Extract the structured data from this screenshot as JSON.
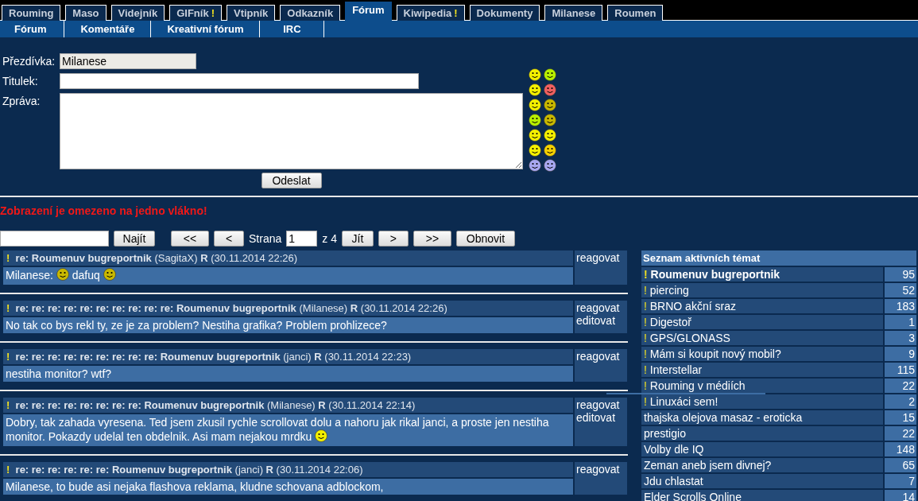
{
  "main_tabs": [
    {
      "label": "Rouming",
      "alert": false,
      "selected": false
    },
    {
      "label": "Maso",
      "alert": false,
      "selected": false
    },
    {
      "label": "Videjník",
      "alert": false,
      "selected": false
    },
    {
      "label": "GIFník",
      "alert": true,
      "selected": false
    },
    {
      "label": "Vtipník",
      "alert": false,
      "selected": false
    },
    {
      "label": "Odkazník",
      "alert": false,
      "selected": false
    },
    {
      "label": "Fórum",
      "alert": false,
      "selected": true
    },
    {
      "label": "Kiwipedia",
      "alert": true,
      "selected": false
    },
    {
      "label": "Dokumenty",
      "alert": false,
      "selected": false
    },
    {
      "label": "Milanese",
      "alert": false,
      "selected": false
    },
    {
      "label": "Roumen",
      "alert": false,
      "selected": false
    }
  ],
  "alert_mark": "!",
  "sub_tabs": [
    "Fórum",
    "Komentáře",
    "Kreativní fórum",
    "IRC"
  ],
  "form": {
    "nick_label": "Přezdívka:",
    "nick_value": "Milanese",
    "title_label": "Titulek:",
    "message_label": "Zpráva:",
    "submit": "Odeslat"
  },
  "notice": "Zobrazení je omezeno na jedno vlákno!",
  "pager": {
    "search_button": "Najít",
    "first": "<<",
    "prev": "<",
    "page_label": "Strana",
    "page_value": "1",
    "of_label": "z 4",
    "go": "Jít",
    "next": ">",
    "last": ">>",
    "refresh": "Obnovit"
  },
  "posts": [
    {
      "mark": "!",
      "prefix": "re:",
      "title": "Roumenuv bugreportnik",
      "author": "(SagitaX)",
      "reply": "R",
      "date": "(30.11.2014 22:26)",
      "body": [
        {
          "kind": "text",
          "text": "Milanese: "
        },
        {
          "kind": "emoticon"
        },
        {
          "kind": "text",
          "text": " dafuq "
        },
        {
          "kind": "emoticon"
        }
      ],
      "actions": [
        "reagovat"
      ]
    },
    {
      "mark": "!",
      "prefix": "re: re: re: re: re: re: re: re: re: re:",
      "title": "Roumenuv bugreportnik",
      "author": "(Milanese)",
      "reply": "R",
      "date": "(30.11.2014 22:26)",
      "body": [
        {
          "kind": "text",
          "text": "No tak co bys rekl ty, ze je za problem? Nestiha grafika? Problem prohlizece?"
        }
      ],
      "actions": [
        "reagovat",
        "editovat"
      ]
    },
    {
      "mark": "!",
      "prefix": "re: re: re: re: re: re: re: re: re:",
      "title": "Roumenuv bugreportnik",
      "author": "(janci)",
      "reply": "R",
      "date": "(30.11.2014 22:23)",
      "body": [
        {
          "kind": "text",
          "text": "nestiha monitor? wtf?"
        }
      ],
      "actions": [
        "reagovat"
      ]
    },
    {
      "mark": "!",
      "prefix": "re: re: re: re: re: re: re: re:",
      "title": "Roumenuv bugreportnik",
      "author": "(Milanese)",
      "reply": "R",
      "date": "(30.11.2014 22:14)",
      "body": [
        {
          "kind": "text",
          "text": "Dobry, tak zahada vyresena. Ted jsem zkusil rychle scrollovat dolu a nahoru jak rikal janci, a proste jen nestiha monitor. Pokazdy udelal ten obdelnik. Asi mam nejakou mrdku "
        },
        {
          "kind": "smiley"
        }
      ],
      "actions": [
        "reagovat",
        "editovat"
      ]
    },
    {
      "mark": "!",
      "prefix": "re: re: re: re: re: re:",
      "title": "Roumenuv bugreportnik",
      "author": "(janci)",
      "reply": "R",
      "date": "(30.11.2014 22:06)",
      "body": [
        {
          "kind": "text",
          "text": "Milanese, to bude asi nejaka flashova reklama, kludne schovana adblockom,"
        }
      ],
      "actions": [
        "reagovat"
      ]
    }
  ],
  "topics": {
    "title": "Seznam aktivních témat",
    "items": [
      {
        "title": "Roumenuv bugreportnik",
        "count": "95",
        "flagged": true,
        "current": true
      },
      {
        "title": "piercing",
        "count": "52",
        "flagged": true,
        "current": false
      },
      {
        "title": "BRNO akční sraz",
        "count": "183",
        "flagged": true,
        "current": false
      },
      {
        "title": "Digestoř",
        "count": "1",
        "flagged": true,
        "current": false
      },
      {
        "title": "GPS/GLONASS",
        "count": "3",
        "flagged": true,
        "current": false
      },
      {
        "title": "Mám si koupit nový mobil?",
        "count": "9",
        "flagged": true,
        "current": false
      },
      {
        "title": "Interstellar",
        "count": "115",
        "flagged": true,
        "current": false
      },
      {
        "title": "Rouming v médiích",
        "count": "22",
        "flagged": true,
        "current": false
      },
      {
        "title": "Linuxáci sem!",
        "count": "2",
        "flagged": true,
        "current": false
      },
      {
        "title": "thajska olejova masaz - eroticka",
        "count": "15",
        "flagged": false,
        "current": false
      },
      {
        "title": "prestigio",
        "count": "22",
        "flagged": false,
        "current": false
      },
      {
        "title": "Volby dle IQ",
        "count": "148",
        "flagged": false,
        "current": false
      },
      {
        "title": "Zeman aneb jsem divnej?",
        "count": "65",
        "flagged": false,
        "current": false
      },
      {
        "title": "Jdu chlastat",
        "count": "7",
        "flagged": false,
        "current": false
      },
      {
        "title": "Elder Scrolls Online",
        "count": "14",
        "flagged": false,
        "current": false
      }
    ]
  }
}
